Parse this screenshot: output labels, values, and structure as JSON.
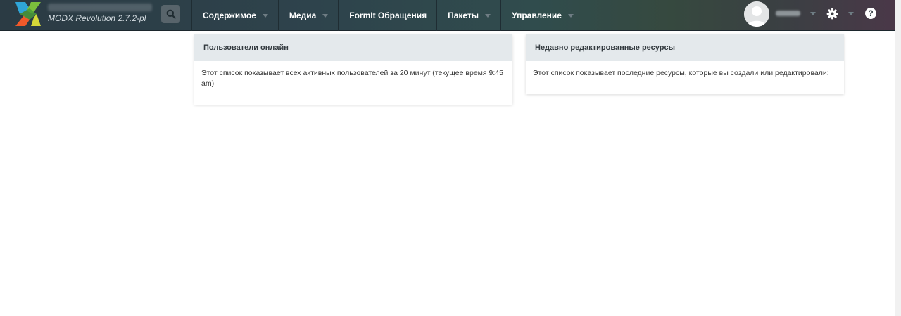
{
  "header": {
    "version": "MODX Revolution 2.7.2-pl",
    "nav": [
      {
        "label": "Содержимое",
        "has_dropdown": true
      },
      {
        "label": "Медиа",
        "has_dropdown": true
      },
      {
        "label": "FormIt Обращения",
        "has_dropdown": false
      },
      {
        "label": "Пакеты",
        "has_dropdown": true
      },
      {
        "label": "Управление",
        "has_dropdown": true
      }
    ],
    "help_label": "?",
    "icons": [
      "modx-logo-icon",
      "search-icon",
      "avatar-icon",
      "gear-icon",
      "help-icon"
    ]
  },
  "panels": {
    "online": {
      "title": "Пользователи онлайн",
      "body": "Этот список показывает всех активных пользователей за 20 минут (текущее время 9:45 am)"
    },
    "recent": {
      "title": "Недавно редактированные ресурсы",
      "body": "Этот список показывает последние ресурсы, которые вы создали или редактировали:"
    }
  },
  "colors": {
    "topbar": "#2e434c",
    "panel_header": "#e4e9ec",
    "logo_green": "#7bbf3c",
    "logo_blue": "#2fa6d9",
    "logo_orange": "#f1592a"
  }
}
